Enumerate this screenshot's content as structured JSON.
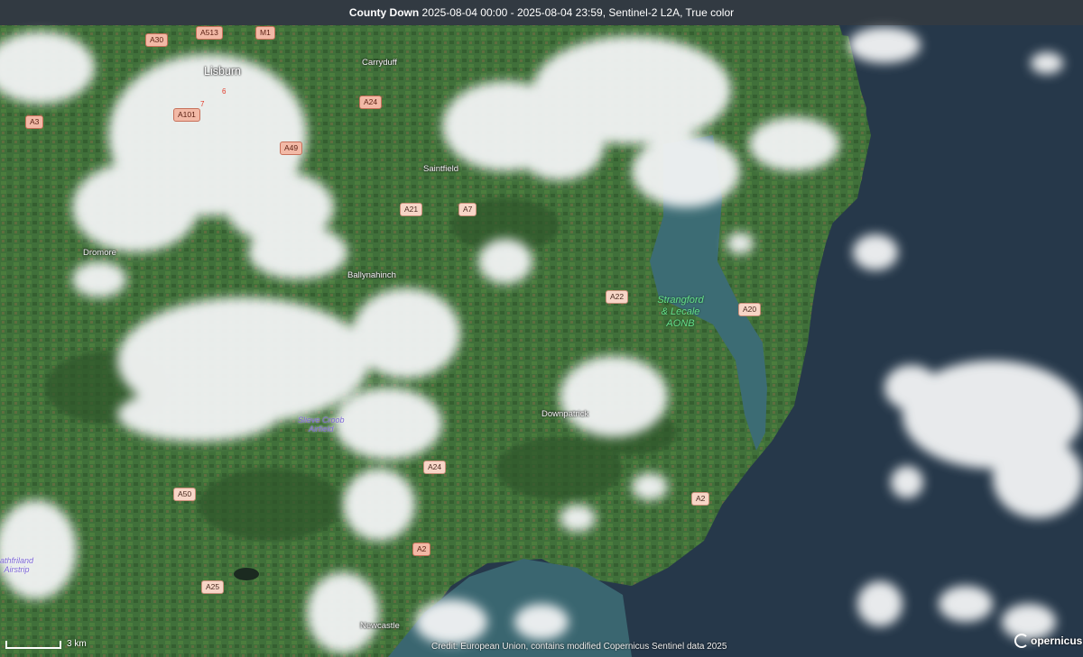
{
  "header": {
    "region": "County Down",
    "details": "2025-08-04 00:00 - 2025-08-04 23:59, Sentinel-2 L2A, True color"
  },
  "roads": [
    {
      "id": "a30",
      "label": "A30",
      "style": "red"
    },
    {
      "id": "a513",
      "label": "A513",
      "style": "red"
    },
    {
      "id": "m1",
      "label": "M1",
      "style": "red"
    },
    {
      "id": "a24-north",
      "label": "A24",
      "style": "red"
    },
    {
      "id": "a3",
      "label": "A3",
      "style": "red"
    },
    {
      "id": "a101",
      "label": "A101",
      "style": "red"
    },
    {
      "id": "a49",
      "label": "A49",
      "style": "red"
    },
    {
      "id": "a21",
      "label": "A21",
      "style": "red"
    },
    {
      "id": "a7",
      "label": "A7",
      "style": "red"
    },
    {
      "id": "a22",
      "label": "A22",
      "style": "green"
    },
    {
      "id": "a20",
      "label": "A20",
      "style": "green"
    },
    {
      "id": "a24-south",
      "label": "A24",
      "style": "red"
    },
    {
      "id": "a2-east",
      "label": "A2",
      "style": "green"
    },
    {
      "id": "a50",
      "label": "A50",
      "style": "green"
    },
    {
      "id": "a2-south",
      "label": "A2",
      "style": "red"
    },
    {
      "id": "a25",
      "label": "A25",
      "style": "green"
    }
  ],
  "towns": {
    "lisburn": "Lisburn",
    "carryduff": "Carryduff",
    "saintfield": "Saintfield",
    "dromore": "Dromore",
    "ballynahinch": "Ballynahinch",
    "downpatrick": "Downpatrick",
    "newcastle": "Newcastle",
    "junction6": "6",
    "junction7": "7"
  },
  "aonb": {
    "line1": "Strangford",
    "line2": "& Lecale",
    "line3": "AONB"
  },
  "poi": {
    "slieve_croob_line1": "Slieve Croob",
    "slieve_croob_line2": "Airfield",
    "rathfriland_line1": "athfriland",
    "rathfriland_line2": "Airstrip"
  },
  "footer": {
    "scale": "3 km",
    "credit": "Credit: European Union, contains modified Copernicus Sentinel data 2025",
    "logo": "opernicus"
  },
  "colors": {
    "land": "#3f6b35",
    "sea": "#2a3c4a",
    "lough": "#3b6f78",
    "cloud": "#f4f4f4",
    "accent_aonb": "#66e08a"
  }
}
